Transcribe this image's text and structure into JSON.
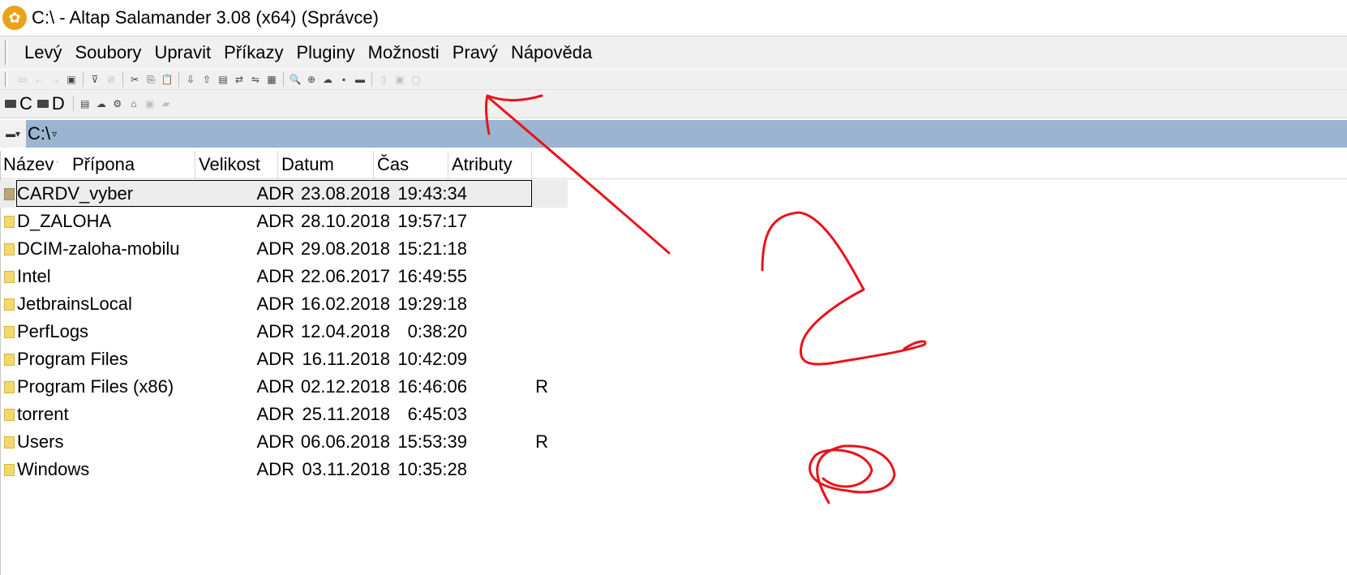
{
  "window": {
    "title": "C:\\ - Altap Salamander 3.08 (x64) (Správce)"
  },
  "menu": [
    "Levý",
    "Soubory",
    "Upravit",
    "Příkazy",
    "Pluginy",
    "Možnosti",
    "Pravý",
    "Nápověda"
  ],
  "drives": {
    "c_label": "C",
    "d_label": "D"
  },
  "path": {
    "value": "C:\\"
  },
  "columns": {
    "name": "Název",
    "ext": "Přípona",
    "size": "Velikost",
    "date": "Datum",
    "time": "Čas",
    "attr": "Atributy"
  },
  "files": [
    {
      "name": "CARDV_vyber",
      "size": "ADR",
      "date": "23.08.2018",
      "time": "19:43:34",
      "attr": ""
    },
    {
      "name": "D_ZALOHA",
      "size": "ADR",
      "date": "28.10.2018",
      "time": "19:57:17",
      "attr": ""
    },
    {
      "name": "DCIM-zaloha-mobilu",
      "size": "ADR",
      "date": "29.08.2018",
      "time": "15:21:18",
      "attr": ""
    },
    {
      "name": "Intel",
      "size": "ADR",
      "date": "22.06.2017",
      "time": "16:49:55",
      "attr": ""
    },
    {
      "name": "JetbrainsLocal",
      "size": "ADR",
      "date": "16.02.2018",
      "time": "19:29:18",
      "attr": ""
    },
    {
      "name": "PerfLogs",
      "size": "ADR",
      "date": "12.04.2018",
      "time": "0:38:20",
      "attr": ""
    },
    {
      "name": "Program Files",
      "size": "ADR",
      "date": "16.11.2018",
      "time": "10:42:09",
      "attr": ""
    },
    {
      "name": "Program Files (x86)",
      "size": "ADR",
      "date": "02.12.2018",
      "time": "16:46:06",
      "attr": "R"
    },
    {
      "name": "torrent",
      "size": "ADR",
      "date": "25.11.2018",
      "time": "6:45:03",
      "attr": ""
    },
    {
      "name": "Users",
      "size": "ADR",
      "date": "06.06.2018",
      "time": "15:53:39",
      "attr": "R"
    },
    {
      "name": "Windows",
      "size": "ADR",
      "date": "03.11.2018",
      "time": "10:35:28",
      "attr": ""
    }
  ],
  "annotation_color": "#e8141b",
  "icons": [
    "salamander-icon",
    "folder-icon",
    "drive-icon",
    "filter-icon"
  ]
}
